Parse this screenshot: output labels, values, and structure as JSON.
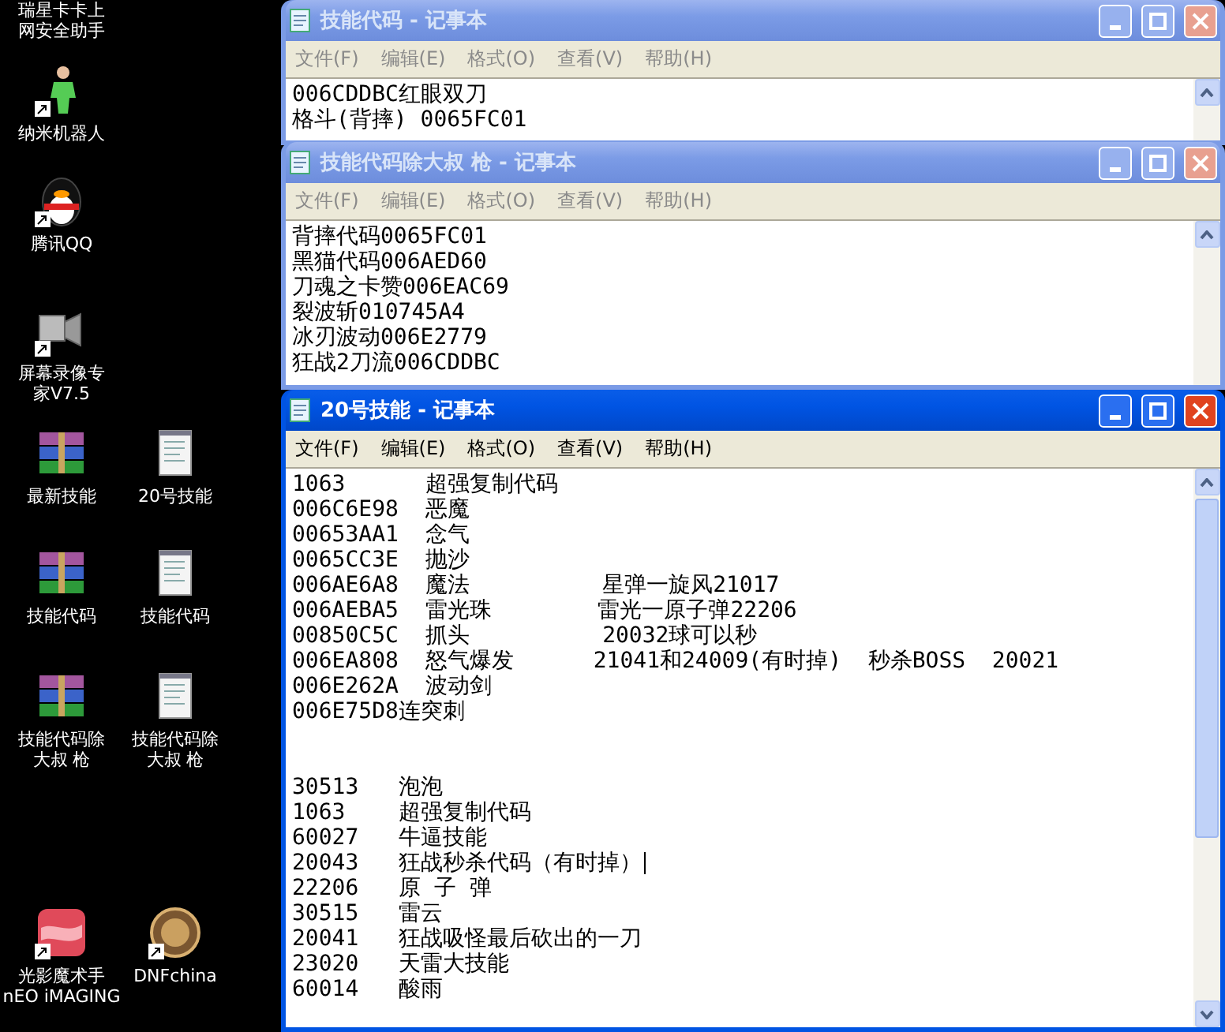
{
  "desktop_icons": [
    {
      "kind": "none",
      "label_lines": [
        "瑞星卡卡上",
        "网安全助手"
      ]
    },
    {
      "kind": "person",
      "shortcut": true,
      "label_lines": [
        "纳米机器人"
      ]
    },
    {
      "kind": "penguin",
      "shortcut": true,
      "label_lines": [
        "腾讯QQ"
      ]
    },
    {
      "kind": "camera",
      "shortcut": true,
      "label_lines": [
        "屏幕录像专",
        "家V7.5"
      ]
    },
    {
      "kind": "archive",
      "shortcut": false,
      "label_lines": [
        "最新技能"
      ]
    },
    {
      "kind": "notepad",
      "shortcut": false,
      "label_lines": [
        "20号技能"
      ]
    },
    {
      "kind": "archive",
      "shortcut": false,
      "label_lines": [
        "技能代码"
      ]
    },
    {
      "kind": "notepad",
      "shortcut": false,
      "label_lines": [
        "技能代码"
      ]
    },
    {
      "kind": "archive",
      "shortcut": false,
      "label_lines": [
        "技能代码除",
        "大叔 枪"
      ]
    },
    {
      "kind": "notepad",
      "shortcut": false,
      "label_lines": [
        "技能代码除",
        "大叔 枪"
      ]
    },
    {
      "kind": "photo",
      "shortcut": true,
      "label_lines": [
        "光影魔术手",
        "nEO iMAGING"
      ]
    },
    {
      "kind": "game-logo",
      "shortcut": true,
      "label_lines": [
        "DNFchina"
      ]
    }
  ],
  "windows": [
    {
      "title": "技能代码 - 记事本",
      "active": false,
      "menu": [
        "文件(F)",
        "编辑(E)",
        "格式(O)",
        "查看(V)",
        "帮助(H)"
      ],
      "paragraphs": [
        [
          {
            "text": "006CDDBC红眼双刀"
          },
          {
            "text": "格斗(背摔) 0065FC01"
          }
        ]
      ]
    },
    {
      "title": "技能代码除大叔 枪 - 记事本",
      "active": false,
      "menu": [
        "文件(F)",
        "编辑(E)",
        "格式(O)",
        "查看(V)",
        "帮助(H)"
      ],
      "paragraphs": [
        [
          {
            "text": "背摔代码0065FC01"
          },
          {
            "text": "黑猫代码006AED60"
          },
          {
            "text": "刀魂之卡赞006EAC69"
          },
          {
            "text": "裂波斩010745A4"
          },
          {
            "text": "冰刃波动006E2779"
          },
          {
            "text": "狂战2刀流006CDDBC"
          }
        ]
      ]
    },
    {
      "title": "20号技能 - 记事本",
      "active": true,
      "menu": [
        "文件(F)",
        "编辑(E)",
        "格式(O)",
        "查看(V)",
        "帮助(H)"
      ],
      "paragraphs": [
        [
          {
            "text": "1063      超强复制代码",
            "caret": false
          },
          {
            "text": "006C6E98  恶魔",
            "caret": false
          },
          {
            "text": "00653AA1  念气",
            "caret": false
          },
          {
            "text": "0065CC3E  抛沙",
            "caret": false
          },
          {
            "text": "006AE6A8  魔法          星弹一旋风21017",
            "caret": false
          },
          {
            "text": "006AEBA5  雷光珠        雷光一原子弹22206",
            "caret": false
          },
          {
            "text": "00850C5C  抓头          20032球可以秒",
            "caret": false
          },
          {
            "text": "006EA808  怒气爆发      21041和24009(有时掉)  秒杀BOSS  20021",
            "caret": false
          },
          {
            "text": "006E262A  波动剑",
            "caret": false
          },
          {
            "text": "006E75D8连突刺",
            "caret": false
          }
        ],
        [
          {
            "text": "30513   泡泡",
            "caret": false
          },
          {
            "text": "1063    超强复制代码",
            "caret": false
          },
          {
            "text": "60027   牛逼技能",
            "caret": false
          },
          {
            "text": "20043   狂战秒杀代码（有时掉）",
            "caret": true
          },
          {
            "text": "22206   原 子 弹",
            "caret": false
          },
          {
            "text": "30515   雷云",
            "caret": false
          },
          {
            "text": "20041   狂战吸怪最后砍出的一刀",
            "caret": false
          },
          {
            "text": "23020   天雷大技能",
            "caret": false
          },
          {
            "text": "60014   酸雨",
            "caret": false
          }
        ]
      ]
    }
  ]
}
